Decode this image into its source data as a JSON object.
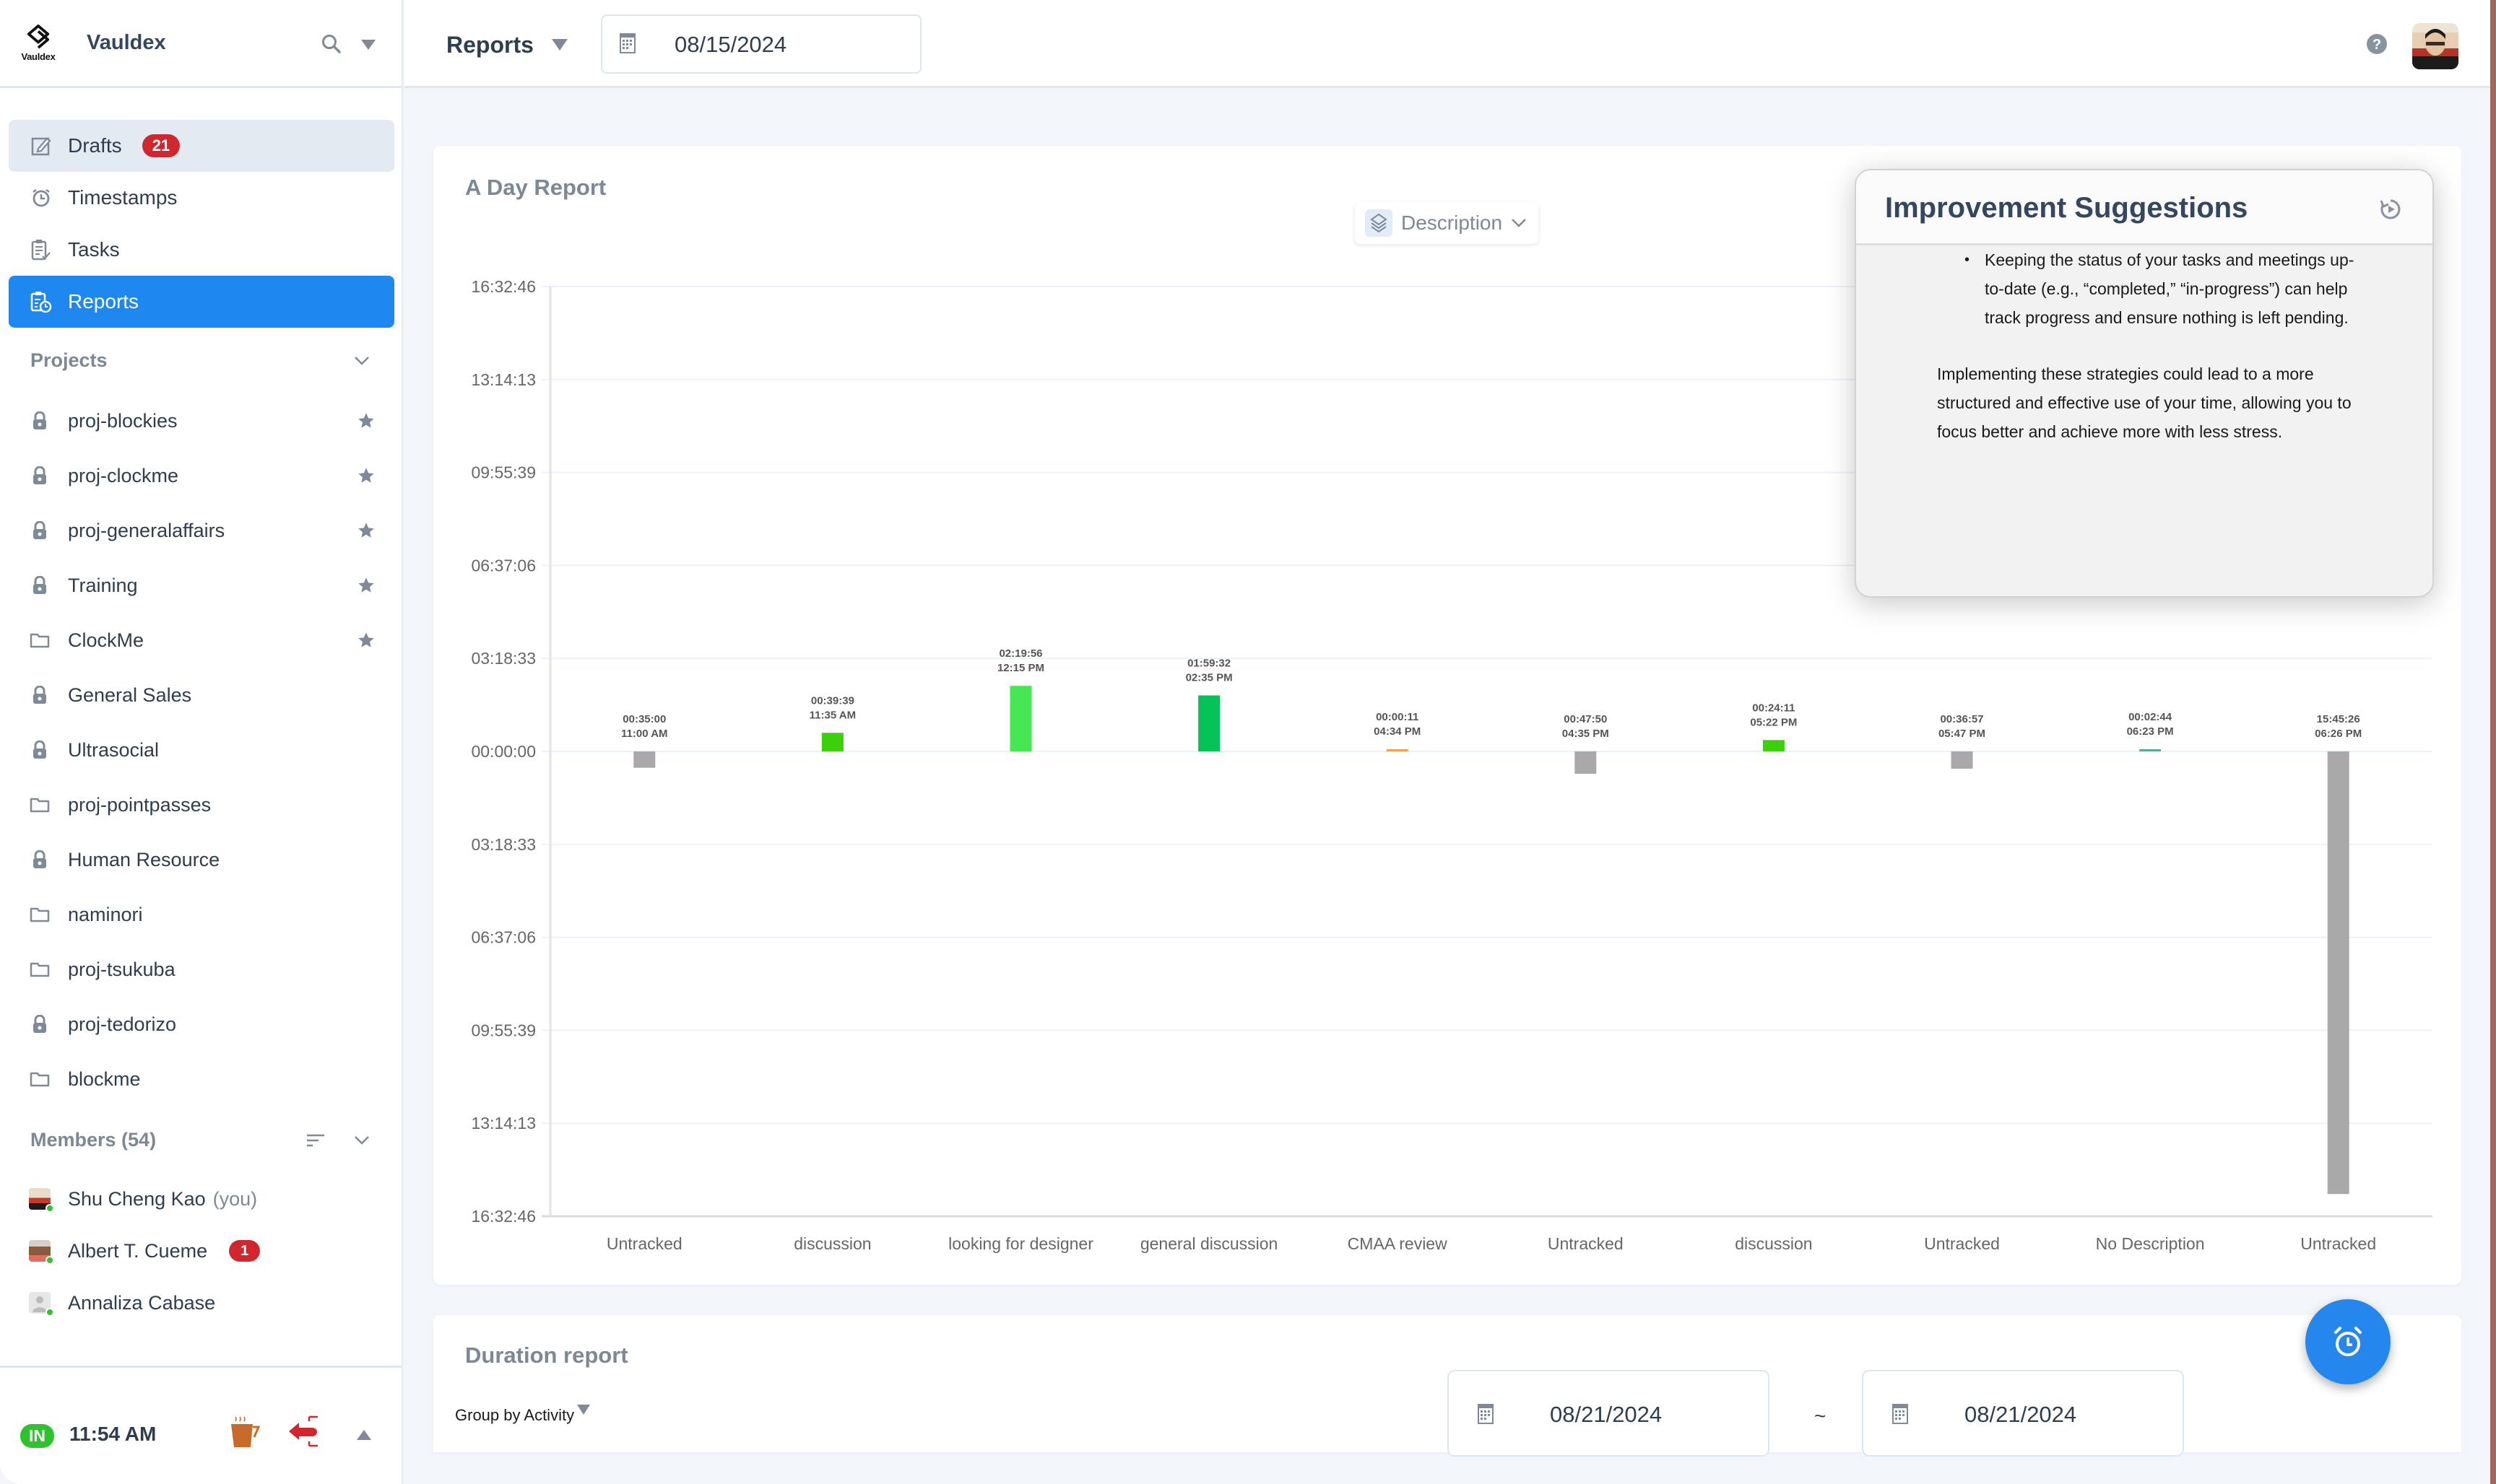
{
  "sidebar": {
    "logo_text": "Vauldex",
    "brand": "Vauldex",
    "nav": [
      {
        "label": "Drafts",
        "icon": "edit-icon",
        "badge": "21"
      },
      {
        "label": "Timestamps",
        "icon": "alarm-clock-icon"
      },
      {
        "label": "Tasks",
        "icon": "clipboard-check-icon"
      },
      {
        "label": "Reports",
        "icon": "report-clock-icon",
        "active": true
      }
    ],
    "projects_heading": "Projects",
    "projects": [
      {
        "name": "proj-blockies",
        "icon": "lock-icon",
        "starred": true
      },
      {
        "name": "proj-clockme",
        "icon": "lock-icon",
        "starred": true
      },
      {
        "name": "proj-generalaffairs",
        "icon": "lock-icon",
        "starred": true
      },
      {
        "name": "Training",
        "icon": "lock-icon",
        "starred": true
      },
      {
        "name": "ClockMe",
        "icon": "folder-icon",
        "starred": true
      },
      {
        "name": "General Sales",
        "icon": "lock-icon",
        "starred": false
      },
      {
        "name": "Ultrasocial",
        "icon": "lock-icon",
        "starred": false
      },
      {
        "name": "proj-pointpasses",
        "icon": "folder-icon",
        "starred": false
      },
      {
        "name": "Human Resource",
        "icon": "lock-icon",
        "starred": false
      },
      {
        "name": "naminori",
        "icon": "folder-icon",
        "starred": false
      },
      {
        "name": "proj-tsukuba",
        "icon": "folder-icon",
        "starred": false
      },
      {
        "name": "proj-tedorizo",
        "icon": "lock-icon",
        "starred": false
      },
      {
        "name": "blockme",
        "icon": "folder-icon",
        "starred": false
      }
    ],
    "members_heading": "Members (54)",
    "members": [
      {
        "name": "Shu Cheng Kao",
        "suffix": "(you)",
        "online": true
      },
      {
        "name": "Albert T. Cueme",
        "badge": "1",
        "online": true
      },
      {
        "name": "Annaliza Cabase",
        "online": true
      }
    ],
    "footer": {
      "status": "IN",
      "time": "11:54 AM"
    }
  },
  "topbar": {
    "title": "Reports",
    "date": "08/15/2024"
  },
  "day_report": {
    "title": "A Day Report",
    "group_select": "Description"
  },
  "suggestions": {
    "title": "Improvement Suggestions",
    "bullet": "Keeping the status of your tasks and meetings up-to-date (e.g., “completed,” “in-progress”) can help track progress and ensure nothing is left pending.",
    "paragraph": "Implementing these strategies could lead to a more structured and effective use of your time, allowing you to focus better and achieve more with less stress."
  },
  "duration_report": {
    "title": "Duration report",
    "group_by": "Group by Activity",
    "from_date": "08/21/2024",
    "separator": "~",
    "to_date": "08/21/2024"
  },
  "colors": {
    "accent": "#1e88f0",
    "badge_red": "#d0262d",
    "online_green": "#2fc22d",
    "untracked_gray": "#a9a9a9"
  },
  "chart_data": {
    "type": "bar",
    "title": "A Day Report",
    "xlabel": "",
    "ylabel": "",
    "y_unit": "seconds (duration, displayed as HH:MM:SS)",
    "ylim": [
      -59566,
      59566
    ],
    "y_ticks": [
      "16:32:46",
      "13:14:13",
      "09:55:39",
      "06:37:06",
      "03:18:33",
      "00:00:00",
      "03:18:33",
      "06:37:06",
      "09:55:39",
      "13:14:13",
      "16:32:46"
    ],
    "y_tick_values": [
      59566,
      47653,
      35739,
      23826,
      11913,
      0,
      -11913,
      -23826,
      -35739,
      -47653,
      -59566
    ],
    "grid": true,
    "categories": [
      "Untracked",
      "discussion",
      "looking for designer",
      "general discussion",
      "CMAA review",
      "Untracked",
      "discussion",
      "Untracked",
      "No Description",
      "Untracked"
    ],
    "bars": [
      {
        "category": "Untracked",
        "duration": "00:35:00",
        "start": "11:00 AM",
        "seconds": 2100,
        "direction": "down",
        "color": "#a9a9a9"
      },
      {
        "category": "discussion",
        "duration": "00:39:39",
        "start": "11:35 AM",
        "seconds": 2379,
        "direction": "up",
        "color": "#3ccf0c"
      },
      {
        "category": "looking for designer",
        "duration": "02:19:56",
        "start": "12:15 PM",
        "seconds": 8396,
        "direction": "up",
        "color": "#45e650"
      },
      {
        "category": "general discussion",
        "duration": "01:59:32",
        "start": "02:35 PM",
        "seconds": 7172,
        "direction": "up",
        "color": "#05c256"
      },
      {
        "category": "CMAA review",
        "duration": "00:00:11",
        "start": "04:34 PM",
        "seconds": 11,
        "direction": "up",
        "color": "#f2a154"
      },
      {
        "category": "Untracked",
        "duration": "00:47:50",
        "start": "04:35 PM",
        "seconds": 2870,
        "direction": "down",
        "color": "#a9a9a9"
      },
      {
        "category": "discussion",
        "duration": "00:24:11",
        "start": "05:22 PM",
        "seconds": 1451,
        "direction": "up",
        "color": "#3ccf0c"
      },
      {
        "category": "Untracked",
        "duration": "00:36:57",
        "start": "05:47 PM",
        "seconds": 2217,
        "direction": "down",
        "color": "#a9a9a9"
      },
      {
        "category": "No Description",
        "duration": "00:02:44",
        "start": "06:23 PM",
        "seconds": 164,
        "direction": "up",
        "color": "#5aa6a0"
      },
      {
        "category": "Untracked",
        "duration": "15:45:26",
        "start": "06:26 PM",
        "seconds": 56726,
        "direction": "down",
        "color": "#a9a9a9"
      }
    ]
  }
}
